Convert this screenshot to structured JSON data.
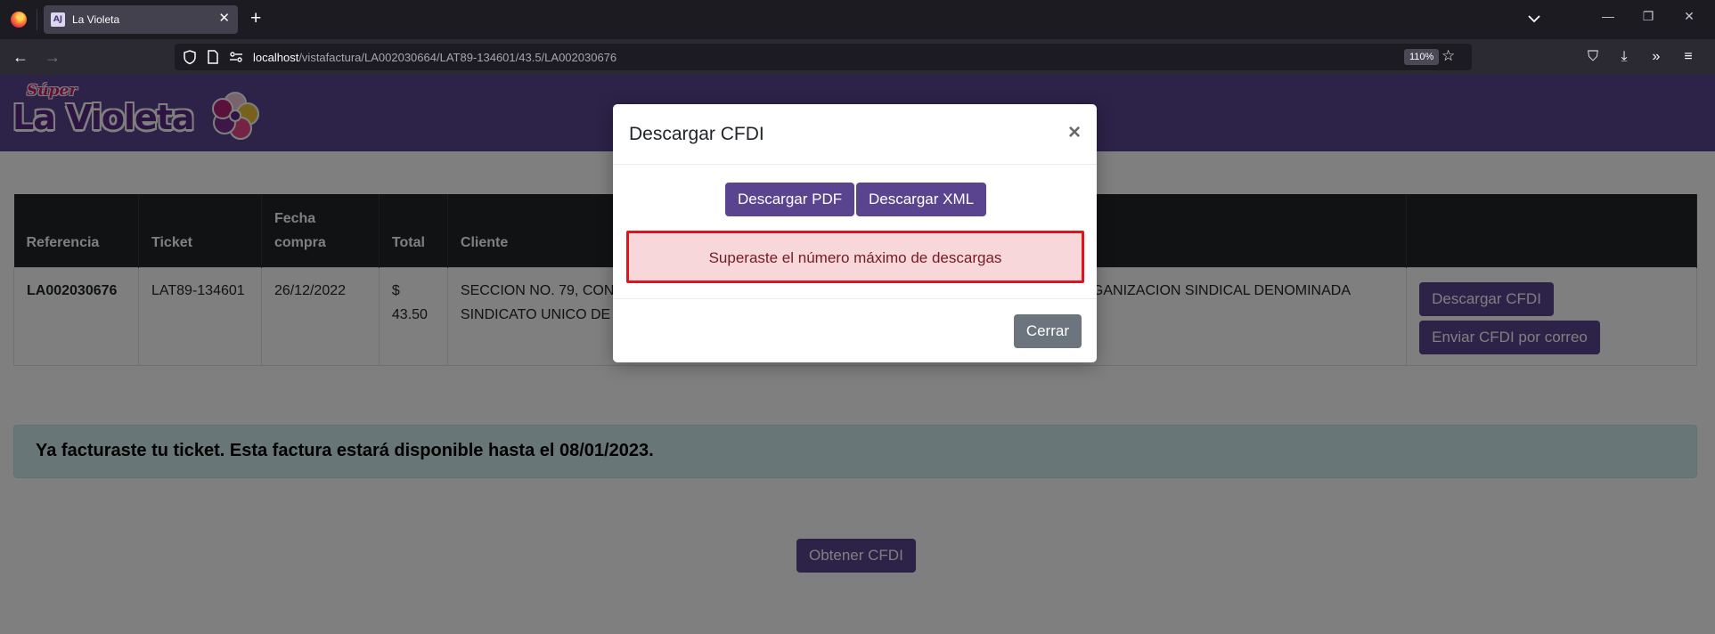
{
  "browser": {
    "tab_title": "La Violeta",
    "favicon_text": "AJ",
    "url_host": "localhost",
    "url_path": "/vistafactura/LA002030664/LAT89-134601/43.5/LA002030676",
    "zoom": "110%"
  },
  "site": {
    "logo_super": "Súper",
    "logo_name": "La Violeta",
    "brand_color": "#5a4490"
  },
  "table": {
    "headers": [
      "Referencia",
      "Ticket",
      "Fecha compra",
      "Total",
      "Cliente",
      ""
    ],
    "row": {
      "referencia": "LA002030676",
      "ticket": "LAT89-134601",
      "fecha": "26/12/2022",
      "total": "$ 43.50",
      "cliente_left": "SECCION NO. 79, CON",
      "cliente_left2": "SINDICATO UNICO DE",
      "cliente_right": "GANIZACION SINDICAL DENOMINADA",
      "descargar_label": "Descargar CFDI",
      "enviar_label": "Enviar CFDI por correo"
    }
  },
  "info_alert": "Ya facturaste tu ticket. Esta factura estará disponible hasta el 08/01/2023.",
  "obtener_label": "Obtener CFDI",
  "modal": {
    "title": "Descargar CFDI",
    "close_glyph": "×",
    "pdf_label": "Descargar PDF",
    "xml_label": "Descargar XML",
    "limit_message": "Superaste el número máximo de descargas",
    "cerrar_label": "Cerrar"
  }
}
